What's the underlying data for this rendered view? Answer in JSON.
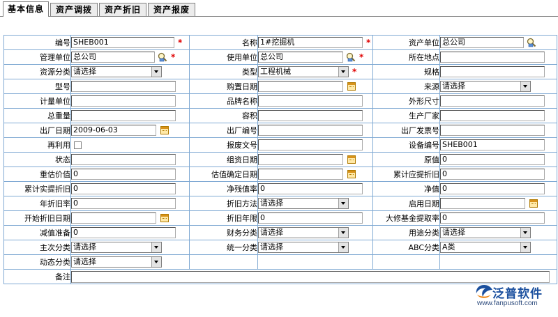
{
  "tabs": [
    {
      "label": "基本信息",
      "active": true
    },
    {
      "label": "资产调拨",
      "active": false
    },
    {
      "label": "资产折旧",
      "active": false
    },
    {
      "label": "资产报废",
      "active": false
    }
  ],
  "form": {
    "code": {
      "label": "编号",
      "value": "SHEB001"
    },
    "name": {
      "label": "名称",
      "value": "1#挖掘机"
    },
    "asset_unit": {
      "label": "资产单位",
      "value": "总公司"
    },
    "manage_unit": {
      "label": "管理单位",
      "value": "总公司"
    },
    "use_unit": {
      "label": "使用单位",
      "value": "总公司"
    },
    "location": {
      "label": "所在地点",
      "value": ""
    },
    "resource_class": {
      "label": "资源分类",
      "value": "请选择"
    },
    "type": {
      "label": "类型",
      "value": "工程机械"
    },
    "spec": {
      "label": "规格",
      "value": ""
    },
    "model": {
      "label": "型号",
      "value": ""
    },
    "purchase_date": {
      "label": "购置日期",
      "value": ""
    },
    "source": {
      "label": "来源",
      "value": "请选择"
    },
    "unit": {
      "label": "计量单位",
      "value": ""
    },
    "brand": {
      "label": "品牌名称",
      "value": ""
    },
    "dimensions": {
      "label": "外形尺寸",
      "value": ""
    },
    "total_weight": {
      "label": "总重量",
      "value": ""
    },
    "volume": {
      "label": "容积",
      "value": ""
    },
    "manufacturer": {
      "label": "生产厂家",
      "value": ""
    },
    "factory_date": {
      "label": "出厂日期",
      "value": "2009-06-03"
    },
    "factory_no": {
      "label": "出厂编号",
      "value": ""
    },
    "invoice_no": {
      "label": "出厂发票号",
      "value": ""
    },
    "reuse": {
      "label": "再利用",
      "checked": false
    },
    "scrap_doc": {
      "label": "报废文号",
      "value": ""
    },
    "device_no": {
      "label": "设备编号",
      "value": "SHEB001"
    },
    "status": {
      "label": "状态",
      "value": ""
    },
    "lease_date": {
      "label": "组资日期",
      "value": ""
    },
    "original_value": {
      "label": "原值",
      "value": "0"
    },
    "reestimate_value": {
      "label": "重估价值",
      "value": "0"
    },
    "estimate_date": {
      "label": "估值确定日期",
      "value": ""
    },
    "accum_due_dep": {
      "label": "累计应提折旧",
      "value": "0"
    },
    "accum_actual_dep": {
      "label": "累计实提折旧",
      "value": "0"
    },
    "net_residual_rate": {
      "label": "净残值率",
      "value": "0"
    },
    "net_value": {
      "label": "净值",
      "value": "0"
    },
    "annual_dep_rate": {
      "label": "年折旧率",
      "value": "0"
    },
    "dep_method": {
      "label": "折旧方法",
      "value": "请选择"
    },
    "enable_date": {
      "label": "启用日期",
      "value": ""
    },
    "dep_start_date": {
      "label": "开始折旧日期",
      "value": ""
    },
    "dep_years": {
      "label": "折旧年限",
      "value": "0"
    },
    "overhaul_rate": {
      "label": "大修基金提取率",
      "value": "0"
    },
    "impairment": {
      "label": "减值准备",
      "value": "0"
    },
    "finance_class": {
      "label": "财务分类",
      "value": "请选择"
    },
    "usage_class": {
      "label": "用途分类",
      "value": "请选择"
    },
    "primary_class": {
      "label": "主次分类",
      "value": "请选择"
    },
    "unified_class": {
      "label": "统一分类",
      "value": "请选择"
    },
    "abc_class": {
      "label": "ABC分类",
      "value": "A类"
    },
    "dynamic_class": {
      "label": "动态分类",
      "value": "请选择"
    },
    "remark": {
      "label": "备注",
      "value": ""
    }
  },
  "required_mark": "*",
  "logo": {
    "name": "泛普软件",
    "url": "www.fanpusoft.com"
  },
  "colors": {
    "border": "#7fa9d3",
    "required": "#e00000",
    "logo": "#1a4f9e"
  }
}
